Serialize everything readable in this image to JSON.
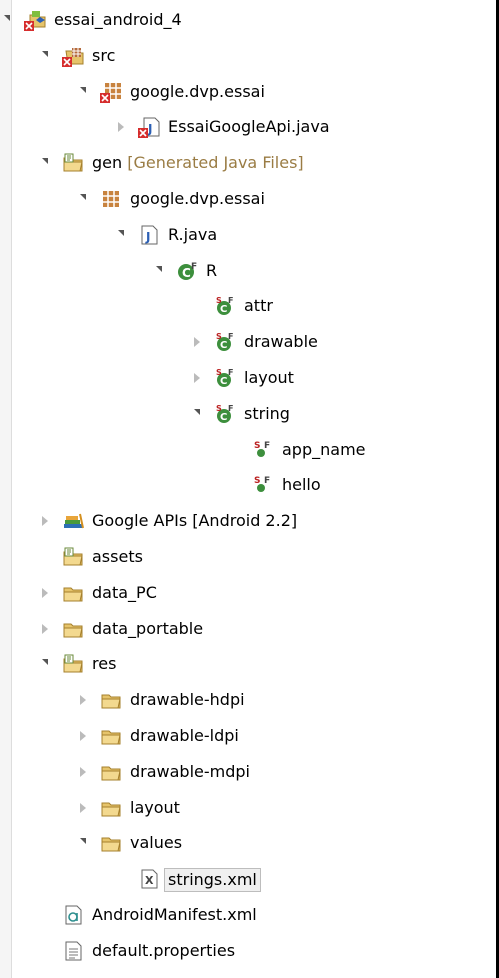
{
  "tree": {
    "rows": [
      {
        "label": "essai_android_4",
        "icon": "android-project-error-icon",
        "depth": 0,
        "expanded": true
      },
      {
        "label": "src",
        "icon": "source-folder-error-icon",
        "depth": 1,
        "expanded": true
      },
      {
        "label": "google.dvp.essai",
        "icon": "package-error-icon",
        "depth": 2,
        "expanded": true
      },
      {
        "label": "EssaiGoogleApi.java",
        "icon": "java-file-error-icon",
        "depth": 3,
        "expanded": false
      },
      {
        "label": "gen",
        "decoration": "[Generated Java Files]",
        "icon": "source-folder-icon",
        "depth": 1,
        "expanded": true
      },
      {
        "label": "google.dvp.essai",
        "icon": "package-icon",
        "depth": 2,
        "expanded": true
      },
      {
        "label": "R.java",
        "icon": "java-file-icon",
        "depth": 3,
        "expanded": true
      },
      {
        "label": "R",
        "icon": "class-icon",
        "depth": 4,
        "expanded": true
      },
      {
        "label": "attr",
        "icon": "inner-class-icon",
        "depth": 5
      },
      {
        "label": "drawable",
        "icon": "inner-class-icon",
        "depth": 5,
        "expanded": false
      },
      {
        "label": "layout",
        "icon": "inner-class-icon",
        "depth": 5,
        "expanded": false
      },
      {
        "label": "string",
        "icon": "inner-class-icon",
        "depth": 5,
        "expanded": true
      },
      {
        "label": "app_name",
        "icon": "static-field-icon",
        "depth": 6
      },
      {
        "label": "hello",
        "icon": "static-field-icon",
        "depth": 6
      },
      {
        "label": "Google APIs [Android 2.2]",
        "icon": "library-icon",
        "depth": 1,
        "expanded": false
      },
      {
        "label": "assets",
        "icon": "source-folder-icon",
        "depth": 1
      },
      {
        "label": "data_PC",
        "icon": "folder-icon",
        "depth": 1,
        "expanded": false
      },
      {
        "label": "data_portable",
        "icon": "folder-icon",
        "depth": 1,
        "expanded": false
      },
      {
        "label": "res",
        "icon": "source-folder-icon",
        "depth": 1,
        "expanded": true
      },
      {
        "label": "drawable-hdpi",
        "icon": "folder-icon",
        "depth": 2,
        "expanded": false
      },
      {
        "label": "drawable-ldpi",
        "icon": "folder-icon",
        "depth": 2,
        "expanded": false
      },
      {
        "label": "drawable-mdpi",
        "icon": "folder-icon",
        "depth": 2,
        "expanded": false
      },
      {
        "label": "layout",
        "icon": "folder-icon",
        "depth": 2,
        "expanded": false
      },
      {
        "label": "values",
        "icon": "folder-icon",
        "depth": 2,
        "expanded": true
      },
      {
        "label": "strings.xml",
        "icon": "xml-file-icon",
        "depth": 3,
        "selected": true
      },
      {
        "label": "AndroidManifest.xml",
        "icon": "manifest-file-icon",
        "depth": 1
      },
      {
        "label": "default.properties",
        "icon": "properties-file-icon",
        "depth": 1
      }
    ]
  }
}
